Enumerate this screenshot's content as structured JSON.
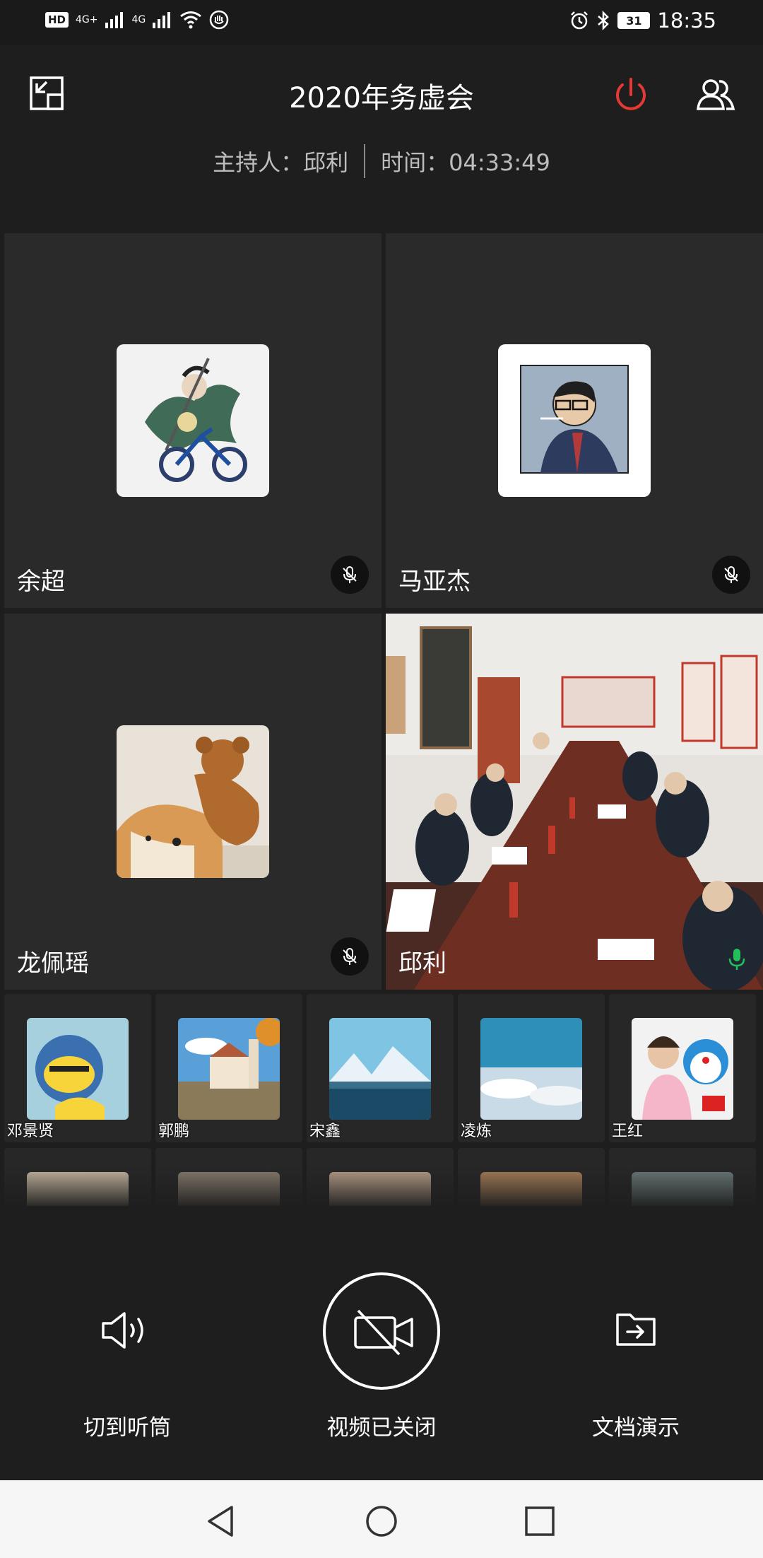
{
  "status_bar": {
    "hd_label": "HD",
    "sim1": "4G+",
    "sim2": "4G",
    "battery": "31",
    "time": "18:35"
  },
  "header": {
    "title": "2020年务虚会",
    "host_label": "主持人：邱利",
    "time_label": "时间：04:33:49"
  },
  "main_tiles": [
    {
      "name": "余超",
      "mic": "muted"
    },
    {
      "name": "马亚杰",
      "mic": "muted"
    },
    {
      "name": "龙佩瑶",
      "mic": "muted"
    },
    {
      "name": "邱利",
      "mic": "active"
    }
  ],
  "thumbnails": [
    {
      "name": "邓景贤"
    },
    {
      "name": "郭鹏"
    },
    {
      "name": "宋鑫"
    },
    {
      "name": "凌炼"
    },
    {
      "name": "王红"
    }
  ],
  "controls": {
    "speaker_label": "切到听筒",
    "video_label": "视频已关闭",
    "share_label": "文档演示"
  },
  "colors": {
    "accent_red": "#e53935",
    "mic_active": "#21c05a",
    "background": "#1e1e1e"
  }
}
